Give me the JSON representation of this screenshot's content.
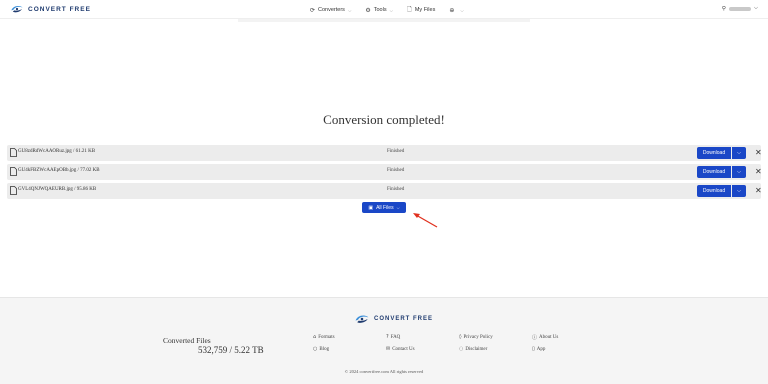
{
  "brand": {
    "name": "CONVERT FREE",
    "primary": "#1a47c7",
    "logo_dark": "#1f3b6f",
    "logo_light": "#3b8fd9"
  },
  "header": {
    "nav": [
      {
        "label": "Converters",
        "icon": "refresh-icon",
        "has_dropdown": true
      },
      {
        "label": "Tools",
        "icon": "gear-icon",
        "has_dropdown": true
      },
      {
        "label": "My Files",
        "icon": "file-icon",
        "has_dropdown": false
      },
      {
        "label": "",
        "icon": "globe-icon",
        "has_dropdown": true
      }
    ],
    "user_icon": "user-icon"
  },
  "main": {
    "headline": "Conversion completed!",
    "files": [
      {
        "name": "GU8zdRdWcAAORuz.jpg / 61.21 KB",
        "status": "Finished",
        "download_label": "Download"
      },
      {
        "name": "GU4kFBZWcAAEpOBb.jpg / 77.02 KB",
        "status": "Finished",
        "download_label": "Download"
      },
      {
        "name": "GVL4QNJWQAEURB.jpg / 95.86 KB",
        "status": "Finished",
        "download_label": "Download"
      }
    ],
    "all_files_label": "All Files"
  },
  "footer": {
    "brand": "CONVERT FREE",
    "stats_label": "Converted Files",
    "stats_value": "532,759 / 5.22 TB",
    "links": [
      {
        "label": "Formats",
        "icon": "tag-icon"
      },
      {
        "label": "FAQ",
        "icon": "question-icon"
      },
      {
        "label": "Privacy Policy",
        "icon": "shield-icon"
      },
      {
        "label": "About Us",
        "icon": "info-icon"
      },
      {
        "label": "Blog",
        "icon": "chat-icon"
      },
      {
        "label": "Contact Us",
        "icon": "mail-icon"
      },
      {
        "label": "Disclaimer",
        "icon": "comment-icon"
      },
      {
        "label": "App",
        "icon": "phone-icon"
      }
    ],
    "copyright": "© 2024 convertfree.com All rights reserved"
  }
}
